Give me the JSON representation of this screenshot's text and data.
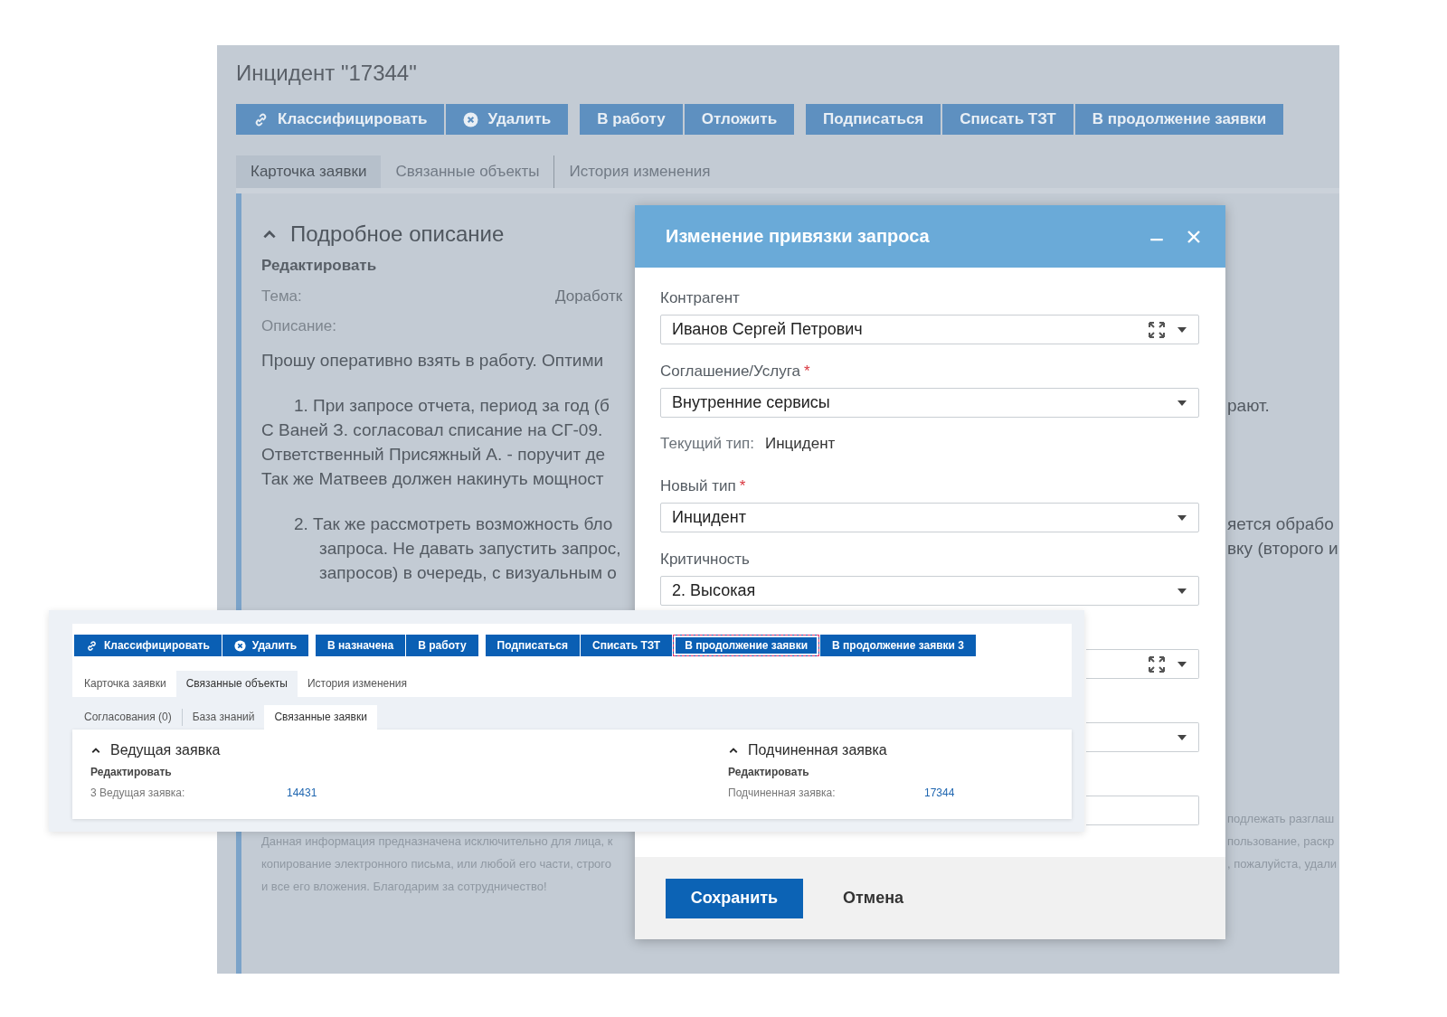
{
  "page": {
    "title": "Инцидент \"17344\"",
    "button_groups": [
      [
        {
          "label": "Классифицировать"
        },
        {
          "label": "Удалить"
        }
      ],
      [
        {
          "label": "В работу"
        },
        {
          "label": "Отложить"
        }
      ],
      [
        {
          "label": "Подписаться"
        },
        {
          "label": "Списать ТЗТ"
        },
        {
          "label": "В продолжение заявки"
        }
      ]
    ],
    "tabs": [
      {
        "label": "Карточка заявки",
        "selected": true
      },
      {
        "label": "Связанные объекты",
        "selected": false
      },
      {
        "label": "История изменения",
        "selected": false
      }
    ],
    "section": {
      "title": "Подробное описание",
      "expanded": true,
      "edit": "Редактировать",
      "subject_label": "Тема:",
      "subject_value": "Доработк",
      "description_label": "Описание:",
      "lines": [
        {
          "kind": "plain",
          "text": "Прошу оперативно взять в работу. Оптими"
        },
        {
          "kind": "gap"
        },
        {
          "kind": "item",
          "text": "1. При запросе отчета, период за год (б",
          "right": "рают."
        },
        {
          "kind": "plain",
          "text": "С Ваней З. согласовал списание на СГ-09."
        },
        {
          "kind": "plain",
          "text": "Ответственный Присяжный А. - поручит де"
        },
        {
          "kind": "plain",
          "text": "Так же Матвеев должен накинуть мощност"
        },
        {
          "kind": "gap"
        },
        {
          "kind": "item",
          "text": "2. Так же рассмотреть возможность бло",
          "right": "яется обрабо"
        },
        {
          "kind": "hang",
          "text": "запроса. Не давать запустить запрос,",
          "right": "вку (второго и"
        },
        {
          "kind": "hang",
          "text": "запросов) в очередь, с визуальным о"
        }
      ],
      "footer_lines": [
        {
          "right": "подлежать разглаш"
        },
        {
          "text": "Данная информация предназначена исключительно для лица, к",
          "right": "пользование, раскр"
        },
        {
          "text": "копирование электронного письма, или любой его части, строго",
          "right": ", пожалуйста, удали"
        },
        {
          "text": "и все его вложения. Благодарим за сотрудничество!"
        }
      ]
    }
  },
  "dialog": {
    "title": "Изменение привязки запроса",
    "fields": [
      {
        "kind": "lookup",
        "label": "Контрагент",
        "value": "Иванов Сергей Петрович"
      },
      {
        "kind": "select",
        "label": "Соглашение/Услуга",
        "required_mark": "*",
        "value": "Внутренние сервисы"
      },
      {
        "kind": "info",
        "label": "Текущий тип:",
        "value": "Инцидент"
      },
      {
        "kind": "select",
        "label": "Новый тип",
        "required_mark": "*",
        "value": "Инцидент"
      },
      {
        "kind": "select",
        "label": "Критичность",
        "value": "2. Высокая"
      },
      {
        "kind": "lookup"
      },
      {
        "kind": "select"
      },
      {
        "kind": "text"
      }
    ],
    "buttons": [
      {
        "kind": "primary",
        "label": "Сохранить"
      },
      {
        "kind": "plain",
        "label": "Отмена"
      }
    ]
  },
  "panel": {
    "button_groups": [
      [
        {
          "label": "Классифицировать",
          "focused": false
        },
        {
          "label": "Удалить",
          "focused": false
        }
      ],
      [
        {
          "label": "В назначена",
          "focused": false
        },
        {
          "label": "В работу",
          "focused": false
        }
      ],
      [
        {
          "label": "Подписаться",
          "focused": false
        },
        {
          "label": "Списать ТЗТ",
          "focused": false
        },
        {
          "label": "В продолжение заявки",
          "focused": true
        },
        {
          "label": "В продолжение заявки 3",
          "focused": false
        }
      ]
    ],
    "tabs": [
      {
        "label": "Карточка заявки",
        "selected": false
      },
      {
        "label": "Связанные объекты",
        "selected": true
      },
      {
        "label": "История изменения",
        "selected": false
      }
    ],
    "subtabs": [
      {
        "label": "Согласования (0)",
        "selected": false
      },
      {
        "label": "База знаний",
        "selected": false
      },
      {
        "label": "Связанные заявки",
        "selected": true
      }
    ],
    "cards": [
      {
        "title": "Ведущая заявка",
        "expanded": true,
        "edit": "Редактировать",
        "label": "3 Ведущая заявка:",
        "value": "14431"
      },
      {
        "title": "Подчиненная заявка",
        "expanded": true,
        "edit": "Редактировать",
        "label": "Подчиненная заявка:",
        "value": "17344"
      }
    ]
  }
}
